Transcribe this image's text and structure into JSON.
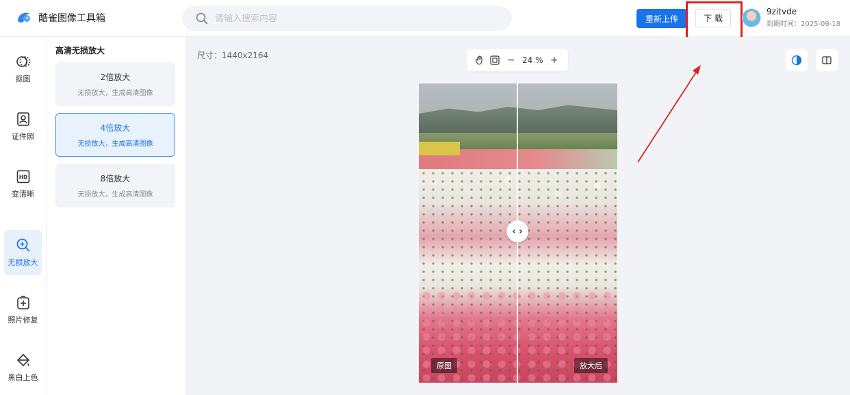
{
  "app": {
    "name": "酷雀图像工具箱"
  },
  "search": {
    "placeholder": "请输入搜索内容"
  },
  "toolbar": {
    "reupload_label": "重新上传",
    "download_label": "下 载"
  },
  "user": {
    "name": "9zitvde",
    "expire": "到期时间：2025-09-18"
  },
  "nav": {
    "items": [
      {
        "label": "抠图",
        "icon": "cutout-icon"
      },
      {
        "label": "证件照",
        "icon": "id-photo-icon"
      },
      {
        "label": "变清晰",
        "icon": "hd-icon"
      },
      {
        "label": "无损放大",
        "icon": "zoom-in-icon"
      },
      {
        "label": "照片修复",
        "icon": "photo-repair-icon"
      },
      {
        "label": "黑白上色",
        "icon": "paint-bucket-icon"
      }
    ],
    "active_index": 3
  },
  "panel": {
    "title": "高清无损放大",
    "options": [
      {
        "title": "2倍放大",
        "desc": "无损放大，生成高清图像"
      },
      {
        "title": "4倍放大",
        "desc": "无损放大，生成高清图像"
      },
      {
        "title": "8倍放大",
        "desc": "无损放大，生成高清图像"
      }
    ],
    "selected_index": 1
  },
  "canvas": {
    "size_info": "尺寸：1440x2164",
    "zoom": "24 %",
    "zoom_minus": "−",
    "zoom_plus": "+",
    "before_label": "原图",
    "after_label": "放大后"
  },
  "colors": {
    "accent": "#1a73e8",
    "highlight": "#e02020"
  }
}
